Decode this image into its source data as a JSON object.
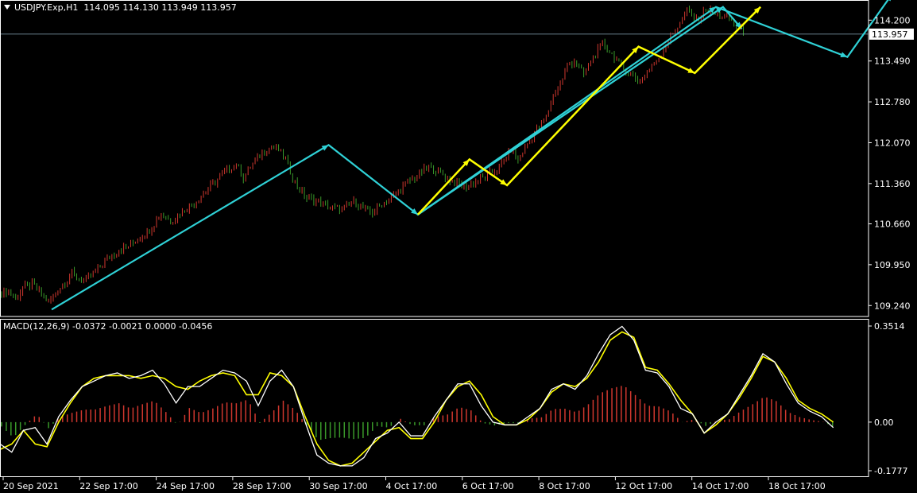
{
  "header": {
    "symbol": "USDJPY.Exp,H1",
    "ohlc": "114.095 114.130 113.949 113.957"
  },
  "macd_header": "MACD(12,26,9) -0.0372 -0.0021 0.0000 -0.0456",
  "current_price": "113.957",
  "colors": {
    "background": "#000000",
    "bull": "#d0372e",
    "bear": "#3a9a2a",
    "cyan": "#2fd1d6",
    "yellow": "#ffff00",
    "macd_line": "#ffffff",
    "signal_line": "#ffff00",
    "grid_border": "#ffffff"
  },
  "chart_data": [
    {
      "type": "line",
      "title": "USDJPY.Exp,H1",
      "xlabel": "",
      "ylabel": "",
      "ylim": [
        109.05,
        114.55
      ],
      "x_tick_labels": [
        "20 Sep 2021",
        "22 Sep 17:00",
        "24 Sep 17:00",
        "28 Sep 17:00",
        "30 Sep 17:00",
        "4 Oct 17:00",
        "6 Oct 17:00",
        "8 Oct 17:00",
        "12 Oct 17:00",
        "14 Oct 17:00",
        "18 Oct 17:00"
      ],
      "y_tick_labels": [
        "114.200",
        "113.490",
        "112.780",
        "112.070",
        "111.360",
        "110.660",
        "109.950",
        "109.240"
      ],
      "y_ticks": [
        114.2,
        113.49,
        112.78,
        112.07,
        111.36,
        110.66,
        109.95,
        109.24
      ],
      "price_path": [
        [
          0,
          109.45
        ],
        [
          3,
          109.5
        ],
        [
          6,
          109.35
        ],
        [
          9,
          109.55
        ],
        [
          13,
          109.6
        ],
        [
          16,
          109.5
        ],
        [
          20,
          109.3
        ],
        [
          26,
          109.6
        ],
        [
          30,
          109.8
        ],
        [
          35,
          109.65
        ],
        [
          40,
          109.85
        ],
        [
          45,
          110.05
        ],
        [
          50,
          110.2
        ],
        [
          55,
          110.3
        ],
        [
          60,
          110.45
        ],
        [
          64,
          110.6
        ],
        [
          68,
          110.85
        ],
        [
          72,
          110.7
        ],
        [
          78,
          110.9
        ],
        [
          84,
          111.1
        ],
        [
          90,
          111.35
        ],
        [
          95,
          111.55
        ],
        [
          100,
          111.7
        ],
        [
          103,
          111.45
        ],
        [
          106,
          111.65
        ],
        [
          110,
          111.85
        ],
        [
          115,
          112.0
        ],
        [
          118,
          111.95
        ],
        [
          121,
          111.8
        ],
        [
          124,
          111.45
        ],
        [
          127,
          111.25
        ],
        [
          130,
          111.1
        ],
        [
          135,
          111.05
        ],
        [
          140,
          110.95
        ],
        [
          145,
          110.9
        ],
        [
          150,
          111.05
        ],
        [
          155,
          110.9
        ],
        [
          158,
          110.85
        ],
        [
          162,
          111.0
        ],
        [
          167,
          111.15
        ],
        [
          172,
          111.35
        ],
        [
          177,
          111.5
        ],
        [
          182,
          111.65
        ],
        [
          187,
          111.55
        ],
        [
          190,
          111.45
        ],
        [
          194,
          111.35
        ],
        [
          198,
          111.3
        ],
        [
          202,
          111.4
        ],
        [
          207,
          111.5
        ],
        [
          212,
          111.65
        ],
        [
          217,
          111.95
        ],
        [
          220,
          111.75
        ],
        [
          224,
          112.05
        ],
        [
          228,
          112.3
        ],
        [
          232,
          112.5
        ],
        [
          235,
          112.9
        ],
        [
          238,
          113.1
        ],
        [
          241,
          113.4
        ],
        [
          244,
          113.5
        ],
        [
          248,
          113.25
        ],
        [
          252,
          113.55
        ],
        [
          256,
          113.8
        ],
        [
          260,
          113.6
        ],
        [
          264,
          113.4
        ],
        [
          268,
          113.25
        ],
        [
          272,
          113.15
        ],
        [
          276,
          113.35
        ],
        [
          280,
          113.55
        ],
        [
          284,
          113.85
        ],
        [
          288,
          114.1
        ],
        [
          292,
          114.35
        ],
        [
          296,
          114.2
        ],
        [
          300,
          114.4
        ],
        [
          304,
          114.3
        ],
        [
          308,
          114.25
        ],
        [
          312,
          114.15
        ],
        [
          316,
          114.0
        ]
      ],
      "series": [
        {
          "name": "",
          "color": "#2fd1d6",
          "points": [
            [
              22,
              109.17
            ],
            [
              140,
              112.03
            ],
            [
              178,
              110.82
            ],
            [
              305,
              114.43
            ],
            [
              361,
              113.56
            ],
            [
              380,
              114.65
            ]
          ]
        },
        {
          "name": "",
          "color": "#2fd1d6",
          "points": [
            [
              178,
              110.82
            ],
            [
              308,
              114.43
            ],
            [
              316,
              114.05
            ]
          ]
        },
        {
          "name": "",
          "color": "#ffff00",
          "points": [
            [
              178,
              110.82
            ],
            [
              200,
              111.78
            ],
            [
              216,
              111.33
            ],
            [
              272,
              113.74
            ],
            [
              296,
              113.28
            ],
            [
              324,
              114.43
            ]
          ]
        }
      ]
    },
    {
      "type": "bar",
      "title": "MACD(12,26,9) -0.0372 -0.0021 0.0000 -0.0456",
      "xlabel": "",
      "ylabel": "",
      "ylim": [
        -0.1777,
        0.3514
      ],
      "y_tick_labels": [
        "0.3514",
        "0.00",
        "-0.1777"
      ],
      "y_ticks": [
        0.3514,
        0.0,
        -0.1777
      ],
      "macd_path": [
        [
          0,
          -0.08
        ],
        [
          5,
          -0.11
        ],
        [
          10,
          -0.03
        ],
        [
          15,
          -0.02
        ],
        [
          20,
          -0.08
        ],
        [
          25,
          0.02
        ],
        [
          30,
          0.08
        ],
        [
          35,
          0.13
        ],
        [
          40,
          0.15
        ],
        [
          45,
          0.17
        ],
        [
          50,
          0.18
        ],
        [
          55,
          0.16
        ],
        [
          60,
          0.17
        ],
        [
          65,
          0.19
        ],
        [
          70,
          0.14
        ],
        [
          75,
          0.07
        ],
        [
          80,
          0.13
        ],
        [
          85,
          0.13
        ],
        [
          90,
          0.16
        ],
        [
          95,
          0.19
        ],
        [
          100,
          0.18
        ],
        [
          105,
          0.15
        ],
        [
          110,
          0.06
        ],
        [
          115,
          0.15
        ],
        [
          120,
          0.19
        ],
        [
          125,
          0.13
        ],
        [
          130,
          0.0
        ],
        [
          135,
          -0.12
        ],
        [
          140,
          -0.15
        ],
        [
          145,
          -0.16
        ],
        [
          150,
          -0.16
        ],
        [
          155,
          -0.13
        ],
        [
          160,
          -0.06
        ],
        [
          165,
          -0.04
        ],
        [
          170,
          0.0
        ],
        [
          175,
          -0.05
        ],
        [
          180,
          -0.05
        ],
        [
          185,
          0.02
        ],
        [
          190,
          0.08
        ],
        [
          195,
          0.14
        ],
        [
          200,
          0.14
        ],
        [
          205,
          0.06
        ],
        [
          210,
          0.0
        ],
        [
          215,
          -0.01
        ],
        [
          220,
          -0.01
        ],
        [
          225,
          0.02
        ],
        [
          230,
          0.05
        ],
        [
          235,
          0.12
        ],
        [
          240,
          0.14
        ],
        [
          245,
          0.12
        ],
        [
          250,
          0.17
        ],
        [
          255,
          0.25
        ],
        [
          260,
          0.32
        ],
        [
          265,
          0.35
        ],
        [
          270,
          0.3
        ],
        [
          275,
          0.19
        ],
        [
          280,
          0.18
        ],
        [
          285,
          0.13
        ],
        [
          290,
          0.05
        ],
        [
          295,
          0.03
        ],
        [
          300,
          -0.04
        ],
        [
          305,
          0.0
        ],
        [
          310,
          0.03
        ],
        [
          315,
          0.1
        ],
        [
          320,
          0.17
        ],
        [
          325,
          0.25
        ],
        [
          330,
          0.22
        ],
        [
          335,
          0.14
        ],
        [
          340,
          0.07
        ],
        [
          345,
          0.04
        ],
        [
          350,
          0.02
        ],
        [
          355,
          -0.02
        ]
      ],
      "signal_path": [
        [
          0,
          -0.1
        ],
        [
          5,
          -0.08
        ],
        [
          10,
          -0.03
        ],
        [
          15,
          -0.08
        ],
        [
          20,
          -0.09
        ],
        [
          25,
          0.0
        ],
        [
          30,
          0.07
        ],
        [
          35,
          0.13
        ],
        [
          40,
          0.16
        ],
        [
          45,
          0.17
        ],
        [
          50,
          0.17
        ],
        [
          55,
          0.17
        ],
        [
          60,
          0.16
        ],
        [
          65,
          0.17
        ],
        [
          70,
          0.16
        ],
        [
          75,
          0.13
        ],
        [
          80,
          0.12
        ],
        [
          85,
          0.15
        ],
        [
          90,
          0.17
        ],
        [
          95,
          0.18
        ],
        [
          100,
          0.17
        ],
        [
          105,
          0.1
        ],
        [
          110,
          0.1
        ],
        [
          115,
          0.18
        ],
        [
          120,
          0.17
        ],
        [
          125,
          0.13
        ],
        [
          130,
          0.02
        ],
        [
          135,
          -0.08
        ],
        [
          140,
          -0.14
        ],
        [
          145,
          -0.16
        ],
        [
          150,
          -0.15
        ],
        [
          155,
          -0.11
        ],
        [
          160,
          -0.07
        ],
        [
          165,
          -0.03
        ],
        [
          170,
          -0.02
        ],
        [
          175,
          -0.06
        ],
        [
          180,
          -0.06
        ],
        [
          185,
          0.0
        ],
        [
          190,
          0.08
        ],
        [
          195,
          0.13
        ],
        [
          200,
          0.15
        ],
        [
          205,
          0.1
        ],
        [
          210,
          0.02
        ],
        [
          215,
          -0.01
        ],
        [
          220,
          -0.01
        ],
        [
          225,
          0.01
        ],
        [
          230,
          0.05
        ],
        [
          235,
          0.11
        ],
        [
          240,
          0.14
        ],
        [
          245,
          0.13
        ],
        [
          250,
          0.16
        ],
        [
          255,
          0.22
        ],
        [
          260,
          0.3
        ],
        [
          265,
          0.33
        ],
        [
          270,
          0.31
        ],
        [
          275,
          0.2
        ],
        [
          280,
          0.19
        ],
        [
          285,
          0.14
        ],
        [
          290,
          0.08
        ],
        [
          295,
          0.03
        ],
        [
          300,
          -0.04
        ],
        [
          305,
          -0.01
        ],
        [
          310,
          0.03
        ],
        [
          315,
          0.09
        ],
        [
          320,
          0.16
        ],
        [
          325,
          0.24
        ],
        [
          330,
          0.22
        ],
        [
          335,
          0.16
        ],
        [
          340,
          0.08
        ],
        [
          345,
          0.05
        ],
        [
          350,
          0.03
        ],
        [
          355,
          0.0
        ]
      ]
    }
  ]
}
